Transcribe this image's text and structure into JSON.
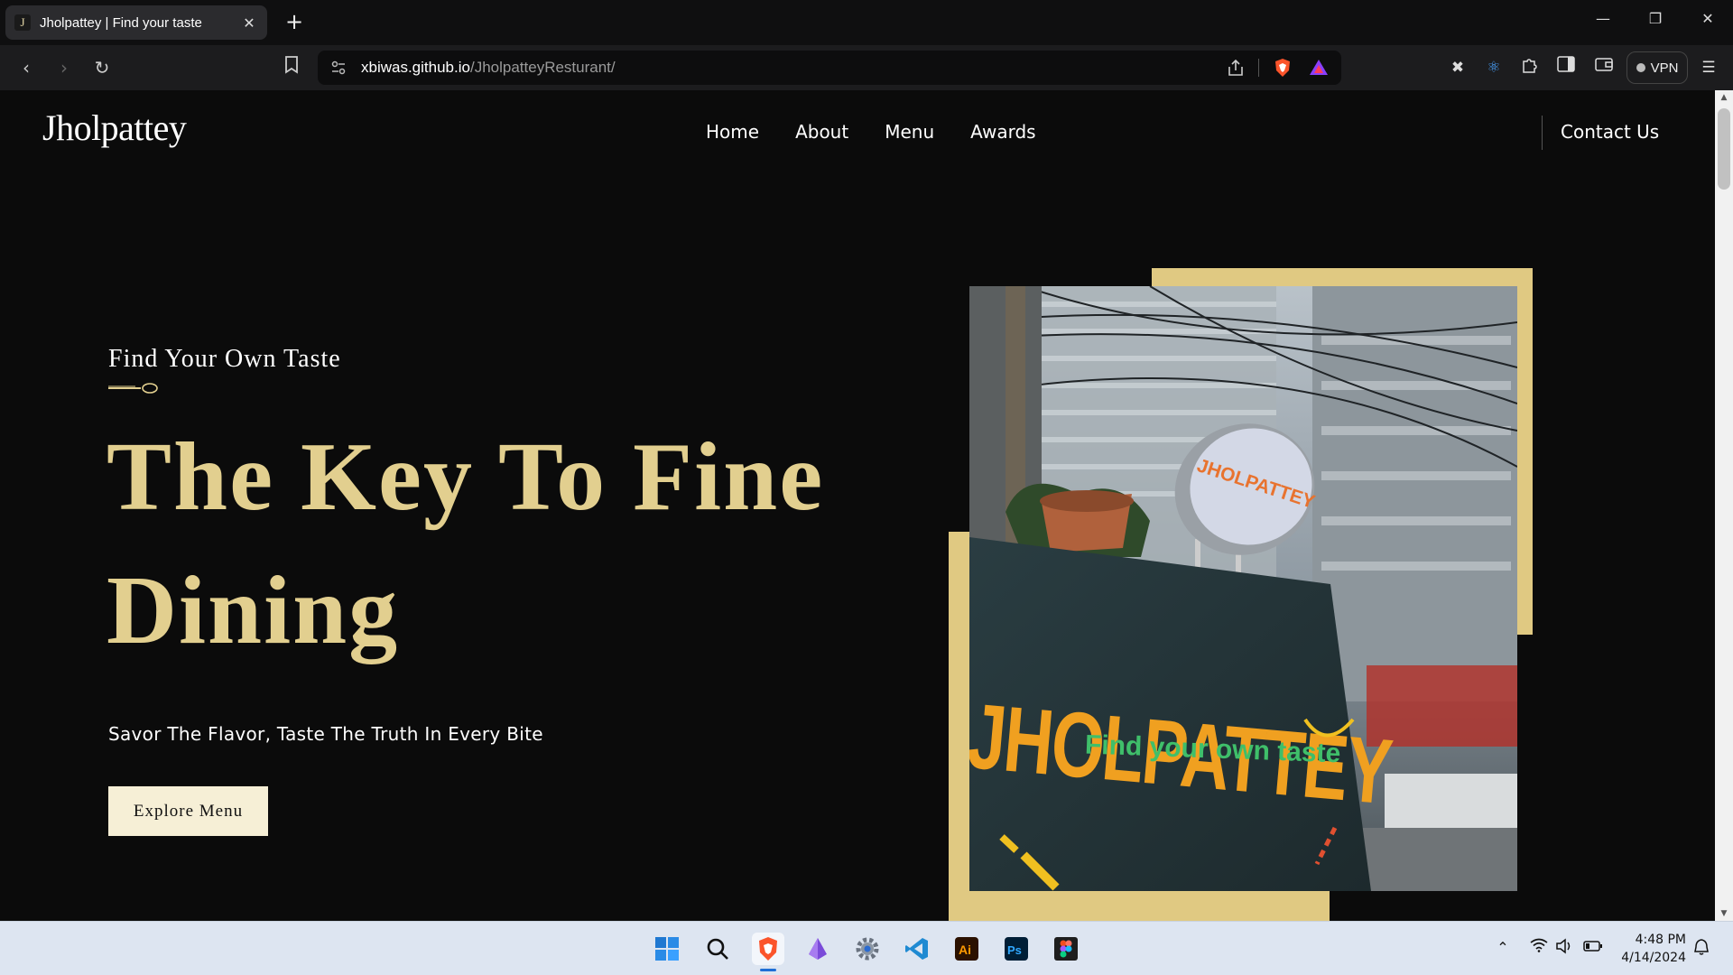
{
  "browser": {
    "tab_title": "Jholpattey | Find your taste",
    "tab_favicon_letter": "J",
    "url_domain": "xbiwas.github.io",
    "url_path": "/JholpatteyResturant/",
    "vpn_label": "VPN"
  },
  "site": {
    "logo": "Jholpattey",
    "nav": [
      "Home",
      "About",
      "Menu",
      "Awards"
    ],
    "contact_label": "Contact Us"
  },
  "hero": {
    "eyebrow": "Find Your Own Taste",
    "headline_line1": "The Key To Fine",
    "headline_line2": "Dining",
    "subheadline": "Savor The Flavor, Taste The Truth In Every Bite",
    "cta_label": "Explore Menu"
  },
  "photo": {
    "sign_text": "JHOLPATTEY",
    "sign_tagline": "Find your own taste",
    "round_sign_text": "JHOLPATTEY"
  },
  "taskbar": {
    "time": "4:48 PM",
    "date": "4/14/2024"
  },
  "colors": {
    "gold": "#e2cf8f",
    "frame_gold": "#e0c982",
    "cta_bg": "#f6efd6",
    "page_bg": "#0b0b0b"
  }
}
